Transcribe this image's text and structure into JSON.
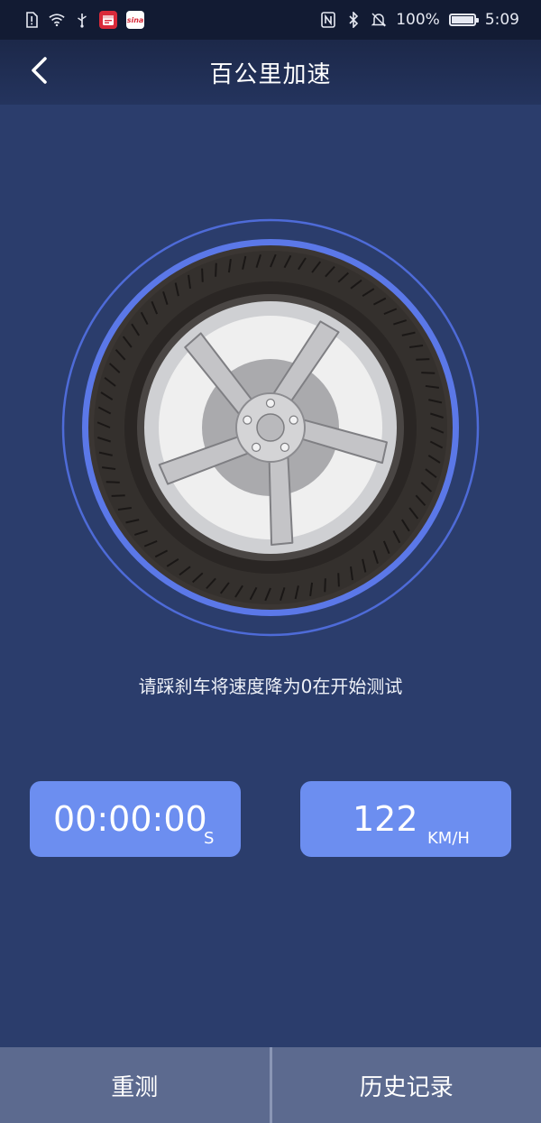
{
  "status_bar": {
    "battery": "100%",
    "battery_level": 1.0,
    "time": "5:09",
    "app_icon_label": "sina",
    "colors": {
      "app_red": "#d92a3a",
      "app_white": "#ffffff"
    }
  },
  "header": {
    "title": "百公里加速",
    "back_icon": "chevron-left-icon"
  },
  "wheel": {
    "icon": "wheel-icon",
    "colors": {
      "ring": "#5b78e8",
      "outer_ring": "#4e6bd8",
      "tire": "#3b3633",
      "rim": "#c9c9cc",
      "disc": "#a8a8ac"
    }
  },
  "hint": "请踩刹车将速度降为0在开始测试",
  "readouts": {
    "time": {
      "value": "00:00:00",
      "unit": "S"
    },
    "speed": {
      "value": "122",
      "unit": "KM/H"
    }
  },
  "bottom": {
    "retest_label": "重测",
    "history_label": "历史记录"
  },
  "colors": {
    "background": "#2b3d6c",
    "accent": "#6c8ef0",
    "bottom_bar": "#5c6a8f"
  }
}
